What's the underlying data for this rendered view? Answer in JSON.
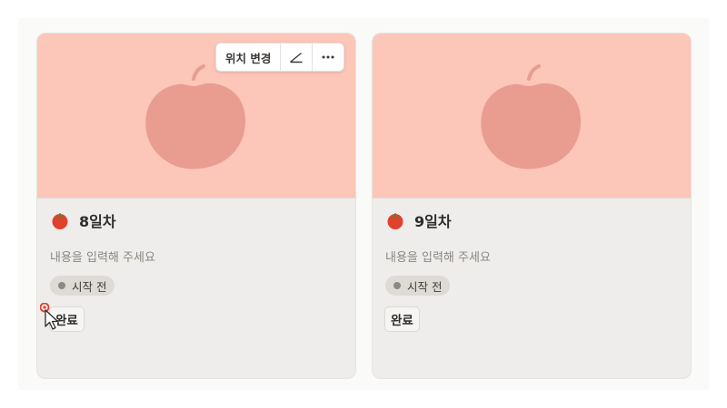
{
  "toolbar": {
    "move_label": "위치 변경",
    "edit_icon": "pencil-icon",
    "more_icon": "more-horizontal-icon"
  },
  "cards": [
    {
      "title": "8일차",
      "description": "내용을 입력해 주세요",
      "status": "시작 전",
      "done_label": "완료",
      "cover_color": "#fcc6b9",
      "icon": "tomato-icon"
    },
    {
      "title": "9일차",
      "description": "내용을 입력해 주세요",
      "status": "시작 전",
      "done_label": "완료",
      "cover_color": "#fcc6b9",
      "icon": "tomato-icon"
    }
  ],
  "colors": {
    "cover": "#fcc6b9",
    "apple": "#e89d90",
    "card_bg": "#efedeb",
    "status_dot": "#8c8884"
  }
}
